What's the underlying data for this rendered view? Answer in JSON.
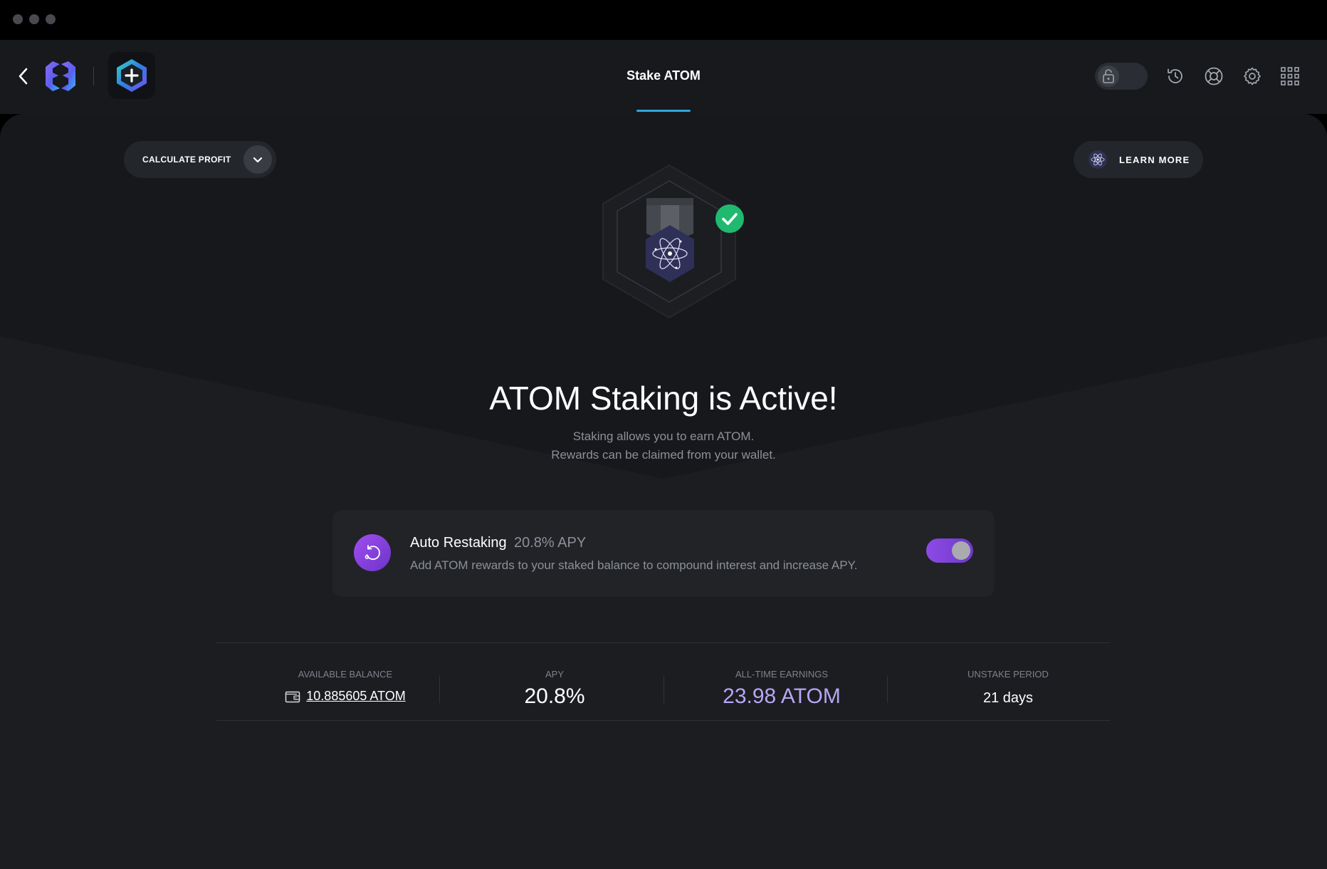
{
  "window": {
    "traffic_lights": [
      "close",
      "minimize",
      "maximize"
    ]
  },
  "header": {
    "title": "Stake ATOM",
    "icons": [
      "back-arrow-icon",
      "exodus-logo-icon",
      "cosmos-app-icon",
      "lock-icon",
      "history-icon",
      "support-icon",
      "gear-icon",
      "apps-grid-icon"
    ]
  },
  "actions": {
    "calculate_profit": "CALCULATE PROFIT",
    "learn_more": "LEARN MORE"
  },
  "hero": {
    "status_icon": "check-icon",
    "badge_icon": "atom-icon"
  },
  "headline": "ATOM Staking is Active!",
  "subtitle": {
    "line1": "Staking allows you to earn ATOM.",
    "line2": "Rewards can be claimed from your wallet."
  },
  "auto_restaking": {
    "title": "Auto Restaking",
    "apy": "20.8% APY",
    "description": "Add ATOM rewards to your staked balance to compound interest and increase APY.",
    "enabled": true
  },
  "stats": {
    "available_balance": {
      "label": "AVAILABLE BALANCE",
      "value": "10.885605 ATOM"
    },
    "apy": {
      "label": "APY",
      "value": "20.8%"
    },
    "all_time_earnings": {
      "label": "ALL-TIME EARNINGS",
      "value": "23.98 ATOM"
    },
    "unstake_period": {
      "label": "UNSTAKE PERIOD",
      "value": "21 days"
    }
  },
  "colors": {
    "accent_blue": "#2fa7d9",
    "accent_purple": "#8e4ae6",
    "earnings_purple": "#b7a6f4",
    "success_green": "#1fba6f",
    "background": "#1b1d21"
  }
}
